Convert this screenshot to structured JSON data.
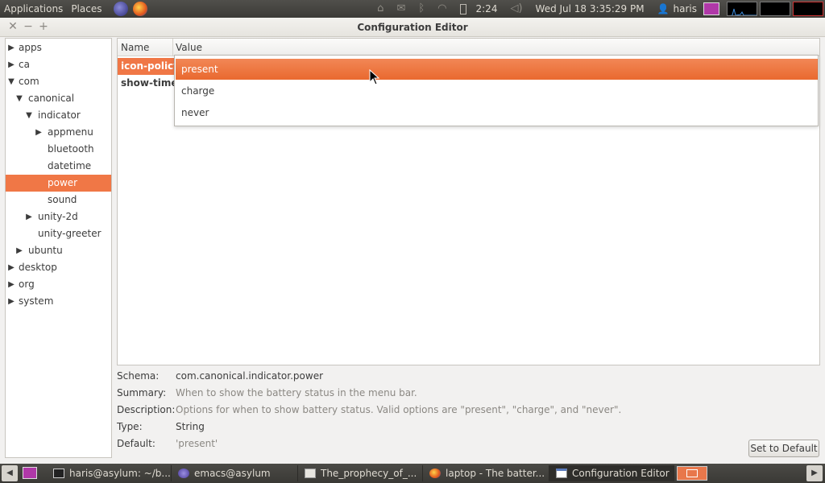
{
  "top_panel": {
    "menus": [
      "Applications",
      "Places"
    ],
    "battery_time": "2:24",
    "clock": "Wed Jul 18  3:35:29 PM",
    "user": "haris"
  },
  "window": {
    "title": "Configuration Editor"
  },
  "tree": {
    "items": [
      {
        "label": "apps",
        "expander": "▶"
      },
      {
        "label": "ca",
        "expander": "▶"
      },
      {
        "label": "com",
        "expander": "▼"
      },
      {
        "label": "canonical",
        "expander": "▼"
      },
      {
        "label": "indicator",
        "expander": "▼"
      },
      {
        "label": "appmenu",
        "expander": "▶"
      },
      {
        "label": "bluetooth",
        "expander": ""
      },
      {
        "label": "datetime",
        "expander": ""
      },
      {
        "label": "power",
        "expander": ""
      },
      {
        "label": "sound",
        "expander": ""
      },
      {
        "label": "unity-2d",
        "expander": "▶"
      },
      {
        "label": "unity-greeter",
        "expander": ""
      },
      {
        "label": "ubuntu",
        "expander": "▶"
      },
      {
        "label": "desktop",
        "expander": "▶"
      },
      {
        "label": "org",
        "expander": "▶"
      },
      {
        "label": "system",
        "expander": "▶"
      }
    ]
  },
  "keylist": {
    "columns": [
      "Name",
      "Value"
    ],
    "rows": [
      {
        "name": "icon-policy"
      },
      {
        "name": "show-time"
      }
    ]
  },
  "dropdown": {
    "options": [
      "present",
      "charge",
      "never"
    ],
    "selected": "present"
  },
  "details": {
    "schema_label": "Schema:",
    "schema_value": "com.canonical.indicator.power",
    "summary_label": "Summary:",
    "summary_value": "When to show the battery status in the menu bar.",
    "description_label": "Description:",
    "description_value": "Options for when to show battery status. Valid options are \"present\", \"charge\", and \"never\".",
    "type_label": "Type:",
    "type_value": "String",
    "default_label": "Default:",
    "default_value": "'present'",
    "set_default_label": "Set to Default"
  },
  "taskbar": {
    "tasks": [
      {
        "label": "haris@asylum: ~/b..."
      },
      {
        "label": "emacs@asylum"
      },
      {
        "label": "The_prophecy_of_..."
      },
      {
        "label": "laptop - The batter..."
      },
      {
        "label": "Configuration Editor"
      }
    ]
  },
  "colors": {
    "accent": "#f07746",
    "panel": "#3c3b37",
    "window_bg": "#f2f1f0"
  }
}
